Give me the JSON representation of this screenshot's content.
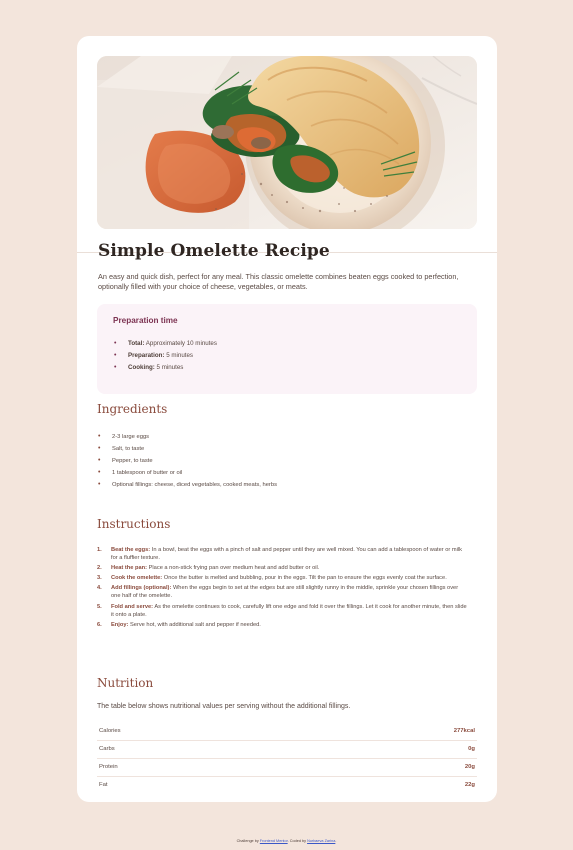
{
  "recipe": {
    "title": "Simple Omelette Recipe",
    "intro": "An easy and quick dish, perfect for any meal. This classic omelette combines beaten eggs cooked to perfection, optionally filled with your choice of cheese, vegetables, or meats."
  },
  "preparation": {
    "title": "Preparation time",
    "items": [
      {
        "label": "Total:",
        "value": "Approximately 10 minutes"
      },
      {
        "label": "Preparation:",
        "value": "5 minutes"
      },
      {
        "label": "Cooking:",
        "value": "5 minutes"
      }
    ]
  },
  "ingredients": {
    "title": "Ingredients",
    "items": [
      "2-3 large eggs",
      "Salt, to taste",
      "Pepper, to taste",
      "1 tablespoon of butter or oil",
      "Optional fillings: cheese, diced vegetables, cooked meats, herbs"
    ]
  },
  "instructions": {
    "title": "Instructions",
    "items": [
      {
        "number": "1.",
        "label": "Beat the eggs:",
        "text": "In a bowl, beat the eggs with a pinch of salt and pepper until they are well mixed. You can add a tablespoon of water or milk for a fluffier texture."
      },
      {
        "number": "2.",
        "label": "Heat the pan:",
        "text": "Place a non-stick frying pan over medium heat and add butter or oil."
      },
      {
        "number": "3.",
        "label": "Cook the omelette:",
        "text": "Once the butter is melted and bubbling, pour in the eggs. Tilt the pan to ensure the eggs evenly coat the surface."
      },
      {
        "number": "4.",
        "label": "Add fillings (optional):",
        "text": "When the eggs begin to set at the edges but are still slightly runny in the middle, sprinkle your chosen fillings over one half of the omelette."
      },
      {
        "number": "5.",
        "label": "Fold and serve:",
        "text": "As the omelette continues to cook, carefully lift one edge and fold it over the fillings. Let it cook for another minute, then slide it onto a plate."
      },
      {
        "number": "6.",
        "label": "Enjoy:",
        "text": "Serve hot, with additional salt and pepper if needed."
      }
    ]
  },
  "nutrition": {
    "title": "Nutrition",
    "intro": "The table below shows nutritional values per serving without the additional fillings.",
    "rows": [
      {
        "label": "Calories",
        "value": "277kcal"
      },
      {
        "label": "Carbs",
        "value": "0g"
      },
      {
        "label": "Protein",
        "value": "20g"
      },
      {
        "label": "Fat",
        "value": "22g"
      }
    ]
  },
  "footer": {
    "prefix": "Challenge by ",
    "challenge_link": "Frontend Mentor",
    "middle": ". Coded by ",
    "author_link": "Nurbaeva Zarina",
    "suffix": "."
  },
  "colors": {
    "page_background": "#f3e5dc",
    "card_background": "#ffffff",
    "accent_brown": "#8a4b3d",
    "prep_box": "#fbf3f8",
    "prep_title": "#7c3352"
  },
  "image": {
    "alt": "omelette-photo"
  }
}
